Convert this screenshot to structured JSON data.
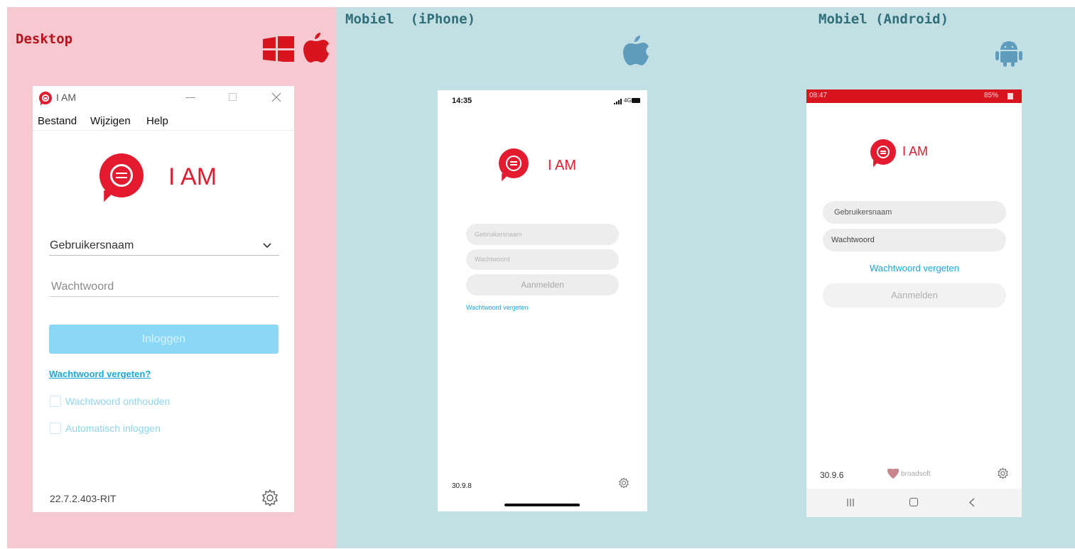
{
  "desktop": {
    "heading": "Desktop",
    "window": {
      "title": "I AM",
      "menu": [
        "Bestand",
        "Wijzigen",
        "Help"
      ],
      "brand": "I AM",
      "username_placeholder": "Gebruikersnaam",
      "password_placeholder": "Wachtwoord",
      "login_button": "Inloggen",
      "forgot_link": "Wachtwoord vergeten?",
      "remember_label": "Wachtwoord onthouden",
      "autologin_label": "Automatisch inloggen",
      "version": "22.7.2.403-RIT"
    }
  },
  "iphone": {
    "heading": "Mobiel  (iPhone)",
    "time": "14:35",
    "signal": "4G",
    "brand": "I AM",
    "username_placeholder": "Gebruikersnaam",
    "password_placeholder": "Wachtwoord",
    "login_button": "Aanmelden",
    "forgot_link": "Wachtwoord vergeten",
    "version": "30.9.8"
  },
  "android": {
    "heading": "Mobiel (Android)",
    "time": "08:47",
    "battery": "85%",
    "brand": "I AM",
    "username_placeholder": "Gebruikersnaam",
    "password_placeholder": "Wachtwoord",
    "forgot_link": "Wachtwoord vergeten",
    "login_button": "Aanmelden",
    "version": "30.9.6",
    "vendor": "broadsoft"
  },
  "colors": {
    "desktop_panel": "#f5c9cf",
    "mobile_panel": "#c2dfe3",
    "brand_red": "#e41b2e",
    "login_blue": "#8ad8f6",
    "link_blue": "#1aa6dc",
    "heading_red": "#b5121b",
    "heading_teal": "#2f6f7a"
  }
}
